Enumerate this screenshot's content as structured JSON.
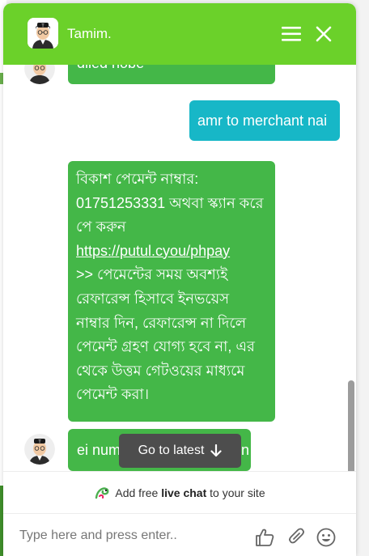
{
  "header": {
    "agent_name": "Tamim.",
    "menu_icon": "hamburger-menu-icon",
    "close_icon": "close-icon"
  },
  "messages": [
    {
      "from": "agent",
      "text": "diled hobe"
    },
    {
      "from": "user",
      "text": "amr to merchant nai"
    },
    {
      "from": "agent",
      "text_before_link": "বিকাশ পেমেন্ট নাম্বার: 01751253331 অথবা স্ক্যান করে পে করুন",
      "link": "https://putul.cyou/phpay",
      "text_after_link": ">> পেমেন্টের সময় অবশ্যই রেফারেন্স হিসাবে ইনভয়েস নাম্বার দিন, রেফারেন্স না দিলে পেমেন্ট গ্রহণ যোগ্য হবে না, এর থেকে উত্তম গেটওয়ের মাধ্যমে পেমেন্ট করা।"
    },
    {
      "from": "agent",
      "text": "ei num",
      "text_tail": "n"
    }
  ],
  "go_to_latest": {
    "label": "Go to latest",
    "icon": "arrow-down-icon"
  },
  "promo": {
    "prefix": "Add free ",
    "bold": "live chat",
    "suffix": " to your site",
    "icon": "chameleon-logo-icon"
  },
  "composer": {
    "placeholder": "Type here and press enter..",
    "like_icon": "thumbs-up-icon",
    "attach_icon": "paperclip-icon",
    "emoji_icon": "emoji-icon"
  },
  "colors": {
    "header": "#6bd12a",
    "agent_bubble": "#44b748",
    "user_bubble": "#17b7c7",
    "go_latest_bg": "#4d4d4d"
  }
}
